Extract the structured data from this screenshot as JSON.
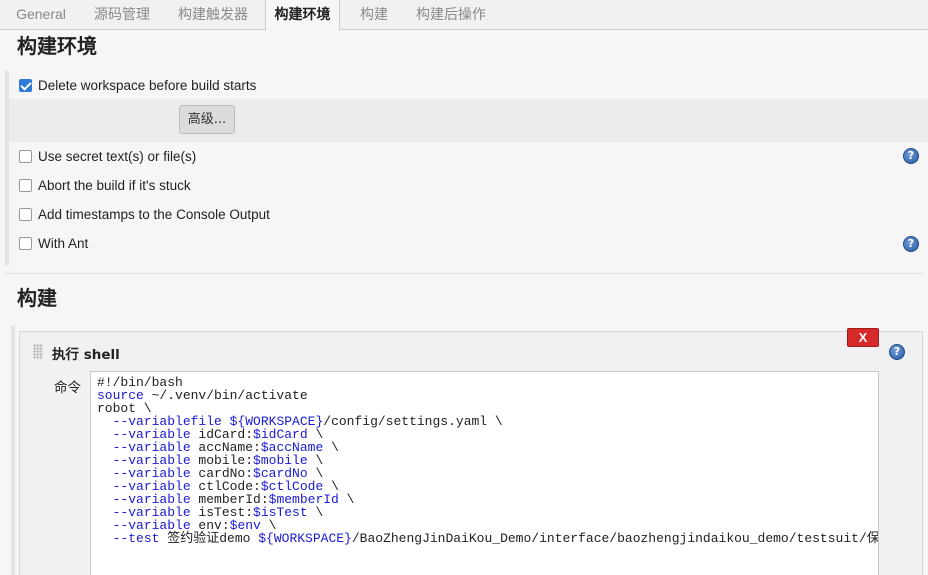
{
  "tabs": [
    {
      "label": "General"
    },
    {
      "label": "源码管理"
    },
    {
      "label": "构建触发器"
    },
    {
      "label": "构建环境"
    },
    {
      "label": "构建"
    },
    {
      "label": "构建后操作"
    }
  ],
  "build_env": {
    "title": "构建环境",
    "delete_workspace": {
      "label": "Delete workspace before build starts",
      "checked": true
    },
    "advanced_button": "高级...",
    "options": [
      {
        "label": "Use secret text(s) or file(s)",
        "checked": false
      },
      {
        "label": "Abort the build if it's stuck",
        "checked": false
      },
      {
        "label": "Add timestamps to the Console Output",
        "checked": false
      },
      {
        "label": "With Ant",
        "checked": false
      }
    ],
    "help_icon": "?"
  },
  "build": {
    "title": "构建",
    "step": {
      "title": "执行 shell",
      "delete_label": "X",
      "command_label": "命令",
      "command_lines": [
        "#!/bin/bash",
        "source ~/.venv/bin/activate",
        "robot \\",
        "  --variablefile ${WORKSPACE}/config/settings.yaml \\",
        "  --variable idCard:$idCard \\",
        "  --variable accName:$accName \\",
        "  --variable mobile:$mobile \\",
        "  --variable cardNo:$cardNo \\",
        "  --variable ctlCode:$ctlCode \\",
        "  --variable memberId:$memberId \\",
        "  --variable isTest:$isTest \\",
        "  --variable env:$env \\",
        "  --test 签约验证demo ${WORKSPACE}/BaoZhengJinDaiKou_Demo/interface/baozhengjindaikou_demo/testsuit/保"
      ]
    }
  },
  "colors": {
    "accent": "#2f7ad6",
    "danger": "#d62a2a",
    "code_keyword": "#1a1ad6"
  }
}
